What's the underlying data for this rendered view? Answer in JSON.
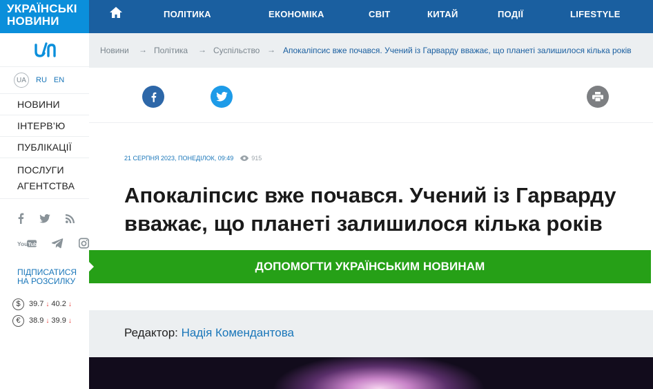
{
  "brand": {
    "line1": "УКРАЇНСЬКІ",
    "line2": "НОВИНИ",
    "colors": {
      "brand_blue": "#0b8fdb",
      "nav_blue": "#1a5fa0",
      "green": "#26a017",
      "link": "#1976b9"
    }
  },
  "languages": {
    "current": "UA",
    "others": [
      "RU",
      "EN"
    ]
  },
  "sidebar_menu": [
    {
      "label": "НОВИНИ"
    },
    {
      "label": "ІНТЕРВ’Ю"
    },
    {
      "label": "ПУБЛІКАЦІЇ"
    },
    {
      "label1": "ПОСЛУГИ",
      "label2": "АГЕНТСТВА"
    }
  ],
  "social_icons": [
    "facebook-icon",
    "twitter-icon",
    "rss-icon",
    "youtube-icon",
    "telegram-icon",
    "instagram-icon"
  ],
  "subscribe_label": "ПІДПИСАТИСЯ НА РОЗСИЛКУ",
  "rates": [
    {
      "icon": "dollar-icon",
      "symbol": "$",
      "buy": "39.7",
      "sell": "40.2"
    },
    {
      "icon": "euro-icon",
      "symbol": "€",
      "buy": "38.9",
      "sell": "39.9"
    }
  ],
  "topnav": {
    "home_icon": "home-icon",
    "items": [
      "ПОЛІТИКА",
      "ЕКОНОМІКА",
      "СВІТ",
      "КИТАЙ",
      "ПОДІЇ",
      "LIFESTYLE"
    ]
  },
  "breadcrumb": {
    "items": [
      "Новини",
      "Політика",
      "Суспільство"
    ],
    "current": "Апокаліпсис вже почався. Учений із Гарварду вважає, що планеті залишилося кілька років"
  },
  "share": {
    "facebook_icon": "facebook-icon",
    "twitter_icon": "twitter-icon",
    "print_icon": "print-icon"
  },
  "article": {
    "date": "21 СЕРПНЯ 2023, ПОНЕДІЛОК, 09:49",
    "views": "915",
    "title": "Апокаліпсис вже почався. Учений із Гарварду вважає, що планеті залишилося кілька років",
    "help_label": "ДОПОМОГТИ УКРАЇНСЬКИМ НОВИНАМ",
    "editor_label": "Редактор:",
    "editor_name": "Надія Комендантова"
  }
}
